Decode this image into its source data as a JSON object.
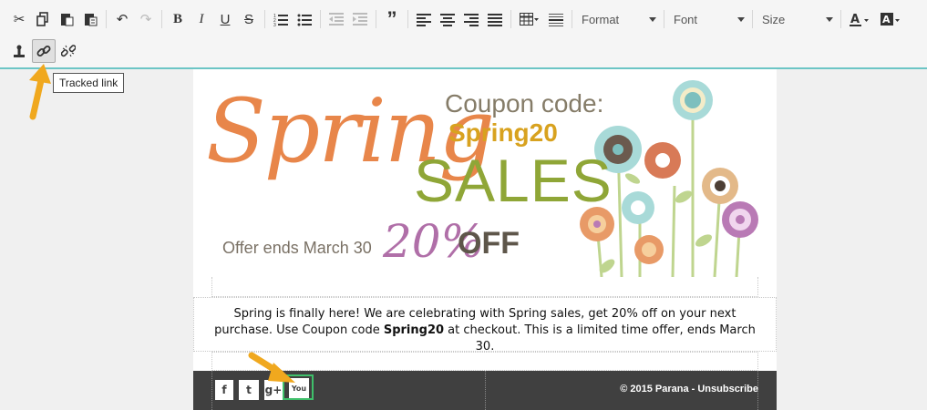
{
  "toolbar": {
    "format_label": "Format",
    "font_label": "Font",
    "size_label": "Size",
    "icons_row1": [
      "cut-icon",
      "copy-icon",
      "paste-icon",
      "paste-text-icon",
      "undo-icon",
      "redo-icon",
      "bold-icon",
      "italic-icon",
      "underline-icon",
      "strikethrough-icon",
      "numbered-list-icon",
      "bullet-list-icon",
      "outdent-icon",
      "indent-icon",
      "blockquote-icon",
      "align-left-icon",
      "align-center-icon",
      "align-right-icon",
      "justify-icon",
      "table-icon",
      "horizontal-rule-icon"
    ],
    "icons_row2": [
      "anchor-icon",
      "tracked-link-icon",
      "unlink-icon"
    ]
  },
  "tooltip": {
    "text": "Tracked link"
  },
  "banner": {
    "spring": "Spring",
    "coupon_label": "Coupon code:",
    "coupon_code": "Spring20",
    "sales": "SALES",
    "offer_ends": "Offer ends March 30",
    "discount": "20%",
    "off": "OFF",
    "colors": {
      "orange": "#e8864a",
      "olive": "#8fa637",
      "gold": "#d8a21f",
      "mauve": "#b06fa8",
      "taupe": "#6e6658"
    }
  },
  "body": {
    "text_before": "Spring is finally here! We are celebrating with Spring sales, get 20% off on your next purchase. Use Coupon code ",
    "code": "Spring20",
    "text_after": " at checkout. This is a limited time offer, ends March 30."
  },
  "footer": {
    "social": [
      {
        "name": "facebook-icon",
        "glyph": "f"
      },
      {
        "name": "twitter-icon",
        "glyph": "t"
      },
      {
        "name": "google-plus-icon",
        "glyph": "g+"
      },
      {
        "name": "youtube-icon",
        "glyph": "You"
      }
    ],
    "copyright": "© 2015 Parana - Unsubscribe"
  }
}
